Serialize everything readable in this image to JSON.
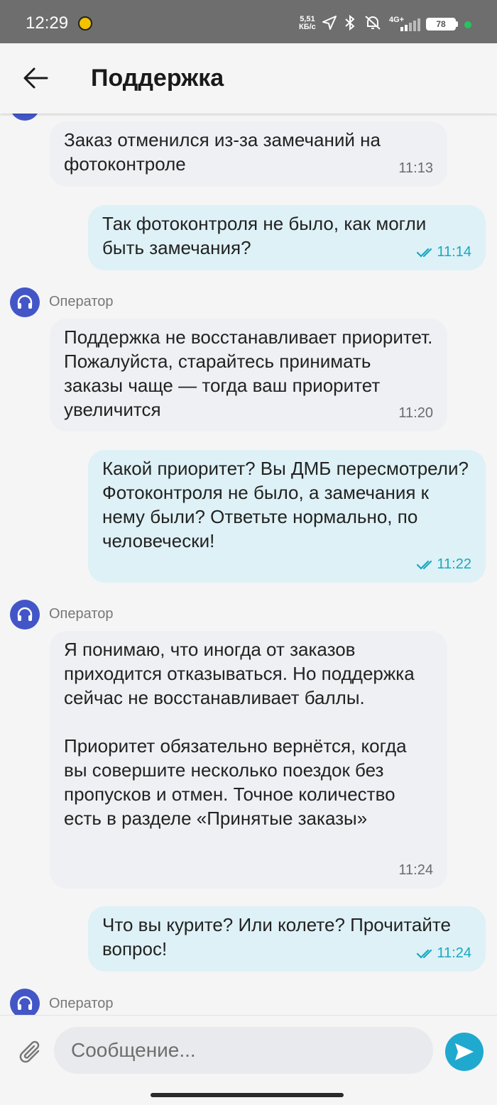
{
  "status_bar": {
    "time": "12:29",
    "net_speed": "5,51",
    "net_unit": "КБ/с",
    "network": "4G+",
    "battery": "78"
  },
  "header": {
    "title": "Поддержка"
  },
  "messages": [
    {
      "from": "operator",
      "text": "Заказ отменился из-за замечаний на фотоконтроле",
      "time": "11:13"
    },
    {
      "from": "me",
      "text": "Так фотоконтроля не было, как могли быть замечания?",
      "time": "11:14"
    },
    {
      "from": "operator",
      "sender": "Оператор",
      "text": "Поддержка не восстанавливает приоритет. Пожалуйста, старайтесь принимать заказы чаще — тогда ваш приоритет увеличится",
      "time": "11:20"
    },
    {
      "from": "me",
      "text": "Какой приоритет? Вы ДМБ пересмотрели? Фотоконтроля не было, а замечания к нему были? Ответьте нормально, по человечески!",
      "time": "11:22"
    },
    {
      "from": "operator",
      "sender": "Оператор",
      "text": "Я понимаю, что иногда от заказов приходится отказываться. Но поддержка сейчас не восстанавливает баллы.\n\nПриоритет обязательно вернётся, когда вы совершите несколько поездок без пропусков и отмен. Точное количество есть в разделе «Принятые заказы»",
      "time": "11:24"
    },
    {
      "from": "me",
      "text": "Что вы курите? Или колете? Прочитайте вопрос!",
      "time": "11:24"
    }
  ],
  "last_sender": "Оператор",
  "input": {
    "placeholder": "Сообщение..."
  },
  "colors": {
    "accent": "#1fa9cf",
    "avatar": "#4356c7",
    "my_bubble": "#def1f6",
    "op_bubble": "#eef0f3"
  }
}
